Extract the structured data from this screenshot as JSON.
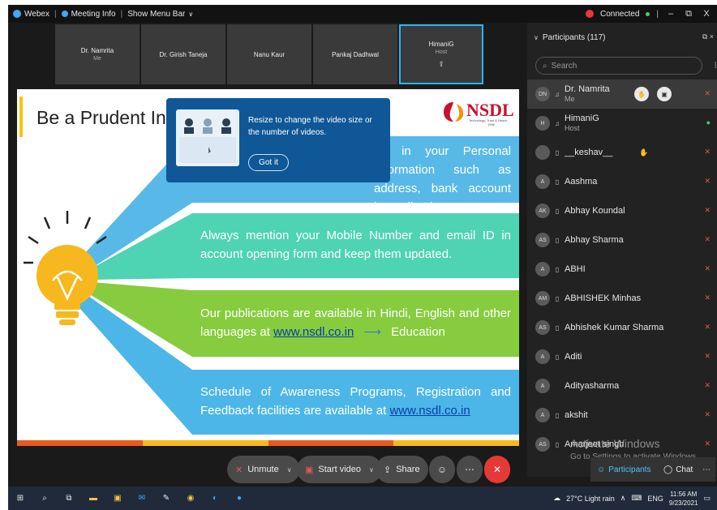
{
  "titlebar": {
    "app": "Webex",
    "meeting_info": "Meeting Info",
    "show_menu_bar": "Show Menu Bar",
    "status": "Connected",
    "minimize": "–",
    "restore": "⧉",
    "close": "X"
  },
  "video_tiles": [
    {
      "name": "Dr. Namrita",
      "sub": "Me"
    },
    {
      "name": "Dr. Girish Taneja",
      "sub": ""
    },
    {
      "name": "Nanu Kaur",
      "sub": ""
    },
    {
      "name": "Pankaj Dadhwal",
      "sub": ""
    },
    {
      "name": "HimaniG",
      "sub": "Host"
    }
  ],
  "slide": {
    "title": "Be a Prudent Inv",
    "brand": "NSDL",
    "brand_tagline": "Technology, Trust & Reach",
    "brand_year": "1996",
    "box1": "ge in your Personal Information such as address, bank account immediately.",
    "box2": "Always mention your Mobile Number and email ID in account opening form and keep them updated.",
    "box3_a": "Our publications are available in Hindi, English and other languages at ",
    "box3_link": "www.nsdl.co.in",
    "box3_b": "Education",
    "box4_a": "Schedule of Awareness Programs, Registration and Feedback facilities are available at ",
    "box4_link": "www.nsdl.co.in",
    "colors": {
      "box1": "#58b9e8",
      "box2": "#4ed3b3",
      "box3": "#86cc3e",
      "box4": "#4cb6e8",
      "bulb": "#f6b81e"
    }
  },
  "tooltip": {
    "text": "Resize to change the video size or the number of videos.",
    "button": "Got it"
  },
  "panel": {
    "title": "Participants (117)",
    "search_placeholder": "Search",
    "participants": [
      {
        "initials": "DN",
        "name": "Dr. Namrita",
        "role": "Me",
        "muted": true
      },
      {
        "initials": "H",
        "name": "HimaniG",
        "role": "Host",
        "muted": false
      },
      {
        "initials": "",
        "name": "__keshav__",
        "role": "",
        "muted": true
      },
      {
        "initials": "A",
        "name": "Aashma",
        "role": "",
        "muted": true
      },
      {
        "initials": "AK",
        "name": "Abhay Koundal",
        "role": "",
        "muted": true
      },
      {
        "initials": "AS",
        "name": "Abhay Sharma",
        "role": "",
        "muted": true
      },
      {
        "initials": "A",
        "name": "ABHI",
        "role": "",
        "muted": true
      },
      {
        "initials": "AM",
        "name": "ABHISHEK Minhas",
        "role": "",
        "muted": true
      },
      {
        "initials": "AS",
        "name": "Abhishek Kumar Sharma",
        "role": "",
        "muted": true
      },
      {
        "initials": "A",
        "name": "Aditi",
        "role": "",
        "muted": true
      },
      {
        "initials": "A",
        "name": "Adityasharma",
        "role": "",
        "muted": true
      },
      {
        "initials": "A",
        "name": "akshit",
        "role": "",
        "muted": true
      },
      {
        "initials": "AS",
        "name": "Amarjeet singh",
        "role": "",
        "muted": true
      }
    ]
  },
  "watermark": {
    "line1": "Activate Windows",
    "line2": "Go to Settings to activate Windows."
  },
  "controls": {
    "unmute": "Unmute",
    "start_video": "Start video",
    "share": "Share",
    "participants": "Participants",
    "chat": "Chat"
  },
  "taskbar": {
    "weather": "27°C  Light rain",
    "language": "ENG",
    "time": "11:56 AM",
    "date": "9/23/2021"
  }
}
